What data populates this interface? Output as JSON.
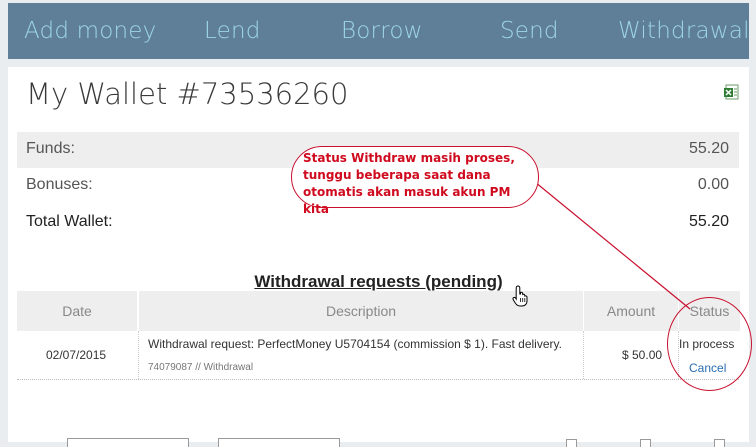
{
  "nav": {
    "items": [
      "Add money",
      "Lend",
      "Borrow",
      "Send",
      "Withdrawal"
    ]
  },
  "wallet": {
    "title": "My Wallet #73536260",
    "export_icon": "excel-icon",
    "funds_label": "Funds:",
    "funds_value": "55.20",
    "bonuses_label": "Bonuses:",
    "bonuses_value": "0.00",
    "total_label": "Total Wallet:",
    "total_value": "55.20"
  },
  "withdrawals": {
    "title": "Withdrawal requests (pending)",
    "columns": [
      "Date",
      "Description",
      "Amount",
      "Status"
    ],
    "rows": [
      {
        "date": "02/07/2015",
        "description": "Withdrawal request: PerfectMoney U5704154 (commission $ 1). Fast delivery.",
        "sub": "74079087 // Withdrawal",
        "amount": "$ 50.00",
        "status": "In process",
        "action": "Cancel"
      }
    ]
  },
  "annotation": {
    "text": "Status Withdraw masih proses, tunggu beberapa saat dana otomatis akan masuk akun PM kita",
    "color": "#d00a1e"
  },
  "colors": {
    "nav_bg": "#5f7f99",
    "nav_text": "#9ed5e6",
    "link": "#2a6eb0"
  }
}
